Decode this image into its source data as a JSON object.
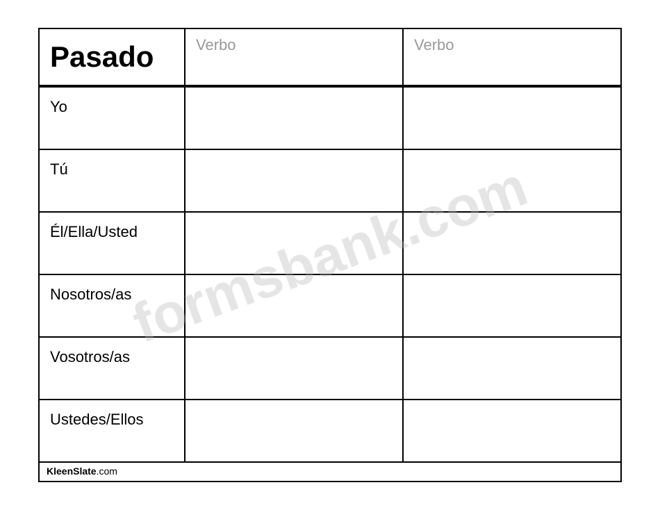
{
  "title": "Pasado",
  "header": {
    "verbo1": "Verbo",
    "verbo2": "Verbo"
  },
  "pronouns": [
    "Yo",
    "Tú",
    "Él/Ella/Usted",
    "Nosotros/as",
    "Vosotros/as",
    "Ustedes/Ellos"
  ],
  "footer": {
    "brand": "KleenSlate",
    "domain": ".com"
  },
  "watermark": "formsbank.com"
}
